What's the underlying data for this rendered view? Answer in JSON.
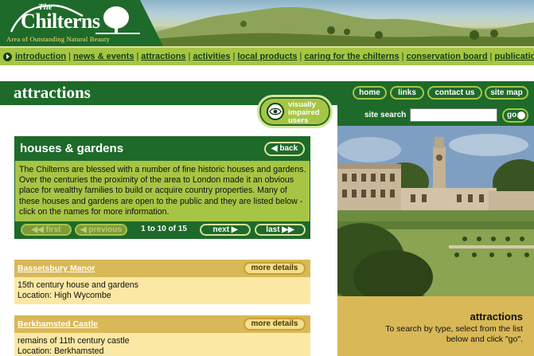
{
  "banner": {
    "logo_the": "The",
    "logo_name": "Chilterns",
    "logo_tagline": "Area of Outstanding Natural Beauty"
  },
  "topnav": {
    "links": [
      {
        "label": "introduction"
      },
      {
        "label": "news & events"
      },
      {
        "label": "attractions"
      },
      {
        "label": "activities"
      },
      {
        "label": "local products"
      },
      {
        "label": "caring for the chilterns"
      },
      {
        "label": "conservation board"
      },
      {
        "label": "publications"
      }
    ]
  },
  "section": {
    "title": "attractions",
    "buttons": {
      "home": "home",
      "links": "links",
      "contact": "contact us",
      "sitemap": "site map"
    },
    "visually_impaired": "visually impaired users"
  },
  "search": {
    "label": "site search",
    "value": "",
    "go": "go"
  },
  "houses": {
    "title": "houses & gardens",
    "back": "back",
    "intro": "The Chilterns are blessed with a number of fine historic houses and gardens. Over the centuries the proximity of the area to London made it an obvious place for wealthy families to build or acquire country properties. Many of these houses and gardens are open to the public and they are listed below - click on the names for more information.",
    "pager": {
      "first": "first",
      "previous": "previous",
      "count": "1 to 10 of 15",
      "next": "next",
      "last": "last"
    }
  },
  "listings": [
    {
      "name": "Bassetsbury Manor",
      "more": "more details",
      "description": "15th century house and gardens",
      "location": "Location: High Wycombe"
    },
    {
      "name": "Berkhamsted Castle",
      "more": "more details",
      "description": "remains of 11th century castle",
      "location": "Location: Berkhamsted"
    }
  ],
  "side_info": {
    "title": "attractions",
    "text": "To search by type, select from the list below and click \"go\"."
  },
  "colors": {
    "dark_green": "#1e6a2a",
    "lime": "#a7c544",
    "gold": "#d9b857",
    "cream": "#fbe8a4"
  }
}
